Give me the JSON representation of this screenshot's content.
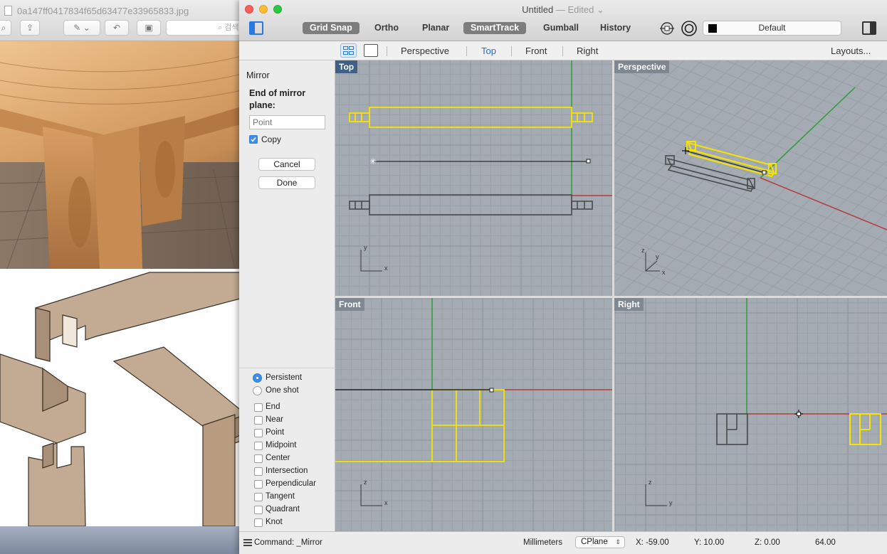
{
  "preview_window": {
    "title": "0a147ff0417834f65d63477e33965833.jpg",
    "search_placeholder": "검색"
  },
  "window": {
    "title": "Untitled",
    "edited": "— Edited ⌄"
  },
  "toolbar": {
    "grid_snap": "Grid Snap",
    "ortho": "Ortho",
    "planar": "Planar",
    "smart_track": "SmartTrack",
    "gumball": "Gumball",
    "history": "History",
    "layer": "Default"
  },
  "tabs": {
    "perspective": "Perspective",
    "top": "Top",
    "front": "Front",
    "right": "Right",
    "layouts": "Layouts..."
  },
  "panel": {
    "command": "Mirror",
    "prompt": "End of mirror plane:",
    "point_placeholder": "Point",
    "copy": "Copy",
    "cancel": "Cancel",
    "done": "Done",
    "persistent": "Persistent",
    "one_shot": "One shot",
    "osnaps": [
      "End",
      "Near",
      "Point",
      "Midpoint",
      "Center",
      "Intersection",
      "Perpendicular",
      "Tangent",
      "Quadrant",
      "Knot"
    ]
  },
  "viewports": {
    "top": "Top",
    "perspective": "Perspective",
    "front": "Front",
    "right": "Right",
    "axis_x": "x",
    "axis_y": "y",
    "axis_z": "z"
  },
  "status": {
    "command": "Command: _Mirror",
    "units": "Millimeters",
    "cplane": "CPlane",
    "x": "X: -59.00",
    "y": "Y: 10.00",
    "z": "Z: 0.00",
    "value": "64.00"
  },
  "colors": {
    "selection": "#f5e400",
    "x_axis": "#b43c3c",
    "y_axis": "#2e9c3a",
    "viewport_bg": "#a5abb2",
    "grid": "#9aa0a7"
  }
}
